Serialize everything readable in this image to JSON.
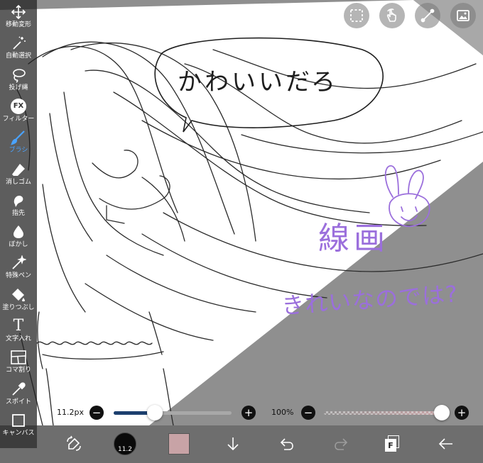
{
  "toolbar": {
    "tools": [
      {
        "label": "移動変形",
        "icon": "move-arrows-icon"
      },
      {
        "label": "自動選択",
        "icon": "magic-wand-icon"
      },
      {
        "label": "投げ縄",
        "icon": "lasso-icon"
      },
      {
        "label": "フィルター",
        "icon": "fx-icon"
      },
      {
        "label": "ブラシ",
        "icon": "brush-icon"
      },
      {
        "label": "消しゴム",
        "icon": "eraser-icon"
      },
      {
        "label": "指先",
        "icon": "finger-smudge-icon"
      },
      {
        "label": "ぼかし",
        "icon": "blur-drop-icon"
      },
      {
        "label": "特殊ペン",
        "icon": "special-pen-icon"
      },
      {
        "label": "塗りつぶし",
        "icon": "fill-bucket-icon"
      },
      {
        "label": "文字入れ",
        "icon": "text-icon"
      },
      {
        "label": "コマ割り",
        "icon": "panel-divide-icon"
      },
      {
        "label": "スポイト",
        "icon": "eyedropper-icon"
      },
      {
        "label": "キャンバス",
        "icon": "canvas-icon"
      }
    ],
    "active_index": 4,
    "active_color": "#4aa3ff"
  },
  "top_buttons": [
    "selection-icon",
    "touch-gesture-icon",
    "ruler-icon",
    "material-image-icon"
  ],
  "canvas": {
    "speech_text": "かわいいだろ",
    "label_lineart": "線画",
    "note_text": "きれいなのでは?",
    "annotation_color": "#9b6fdc"
  },
  "sliders": {
    "brush_size_label": "11.2px",
    "brush_size_fraction": 0.35,
    "opacity_label": "100%",
    "opacity_fraction": 1.0,
    "minus": "−",
    "plus": "+"
  },
  "bottom": {
    "brush_badge": "11.2",
    "current_color": "#c8a3a6",
    "layer_badge": "F",
    "icons": [
      "swap-draw-icon",
      "download-arrow-icon",
      "undo-icon",
      "redo-icon",
      "layers-icon",
      "back-arrow-icon"
    ]
  }
}
